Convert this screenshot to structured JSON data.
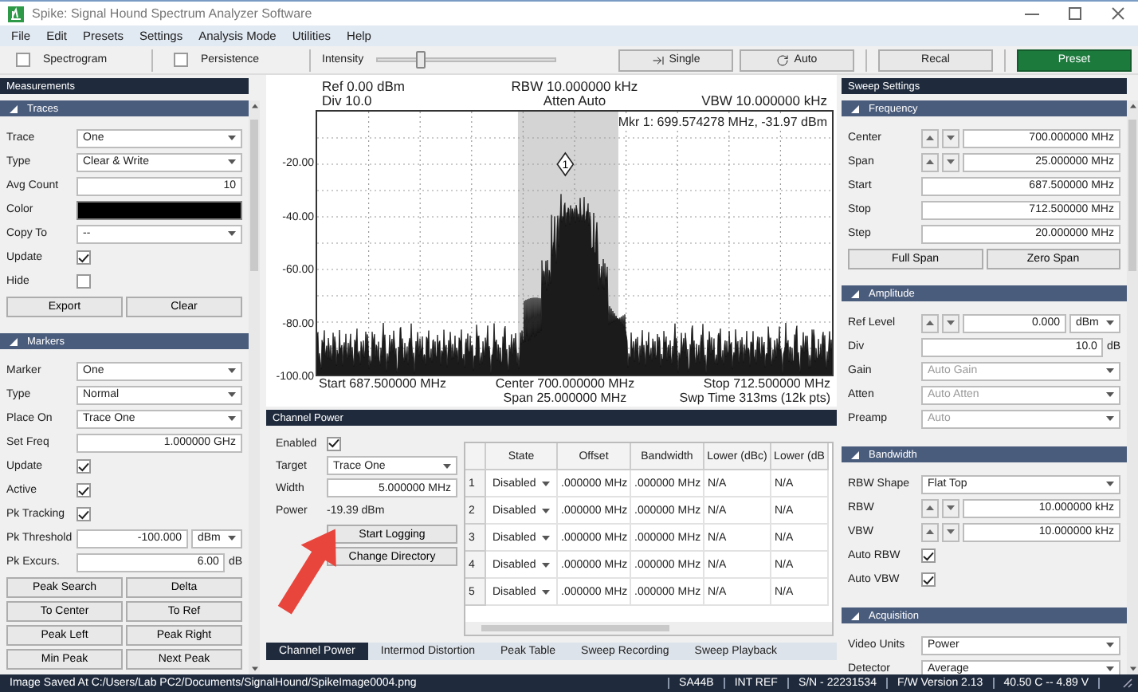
{
  "window": {
    "title": "Spike: Signal Hound Spectrum Analyzer Software"
  },
  "menu": [
    "File",
    "Edit",
    "Presets",
    "Settings",
    "Analysis Mode",
    "Utilities",
    "Help"
  ],
  "toolbar": {
    "checks": [
      {
        "label": "Spectrogram",
        "checked": false
      },
      {
        "label": "Persistence",
        "checked": false
      }
    ],
    "intensity": {
      "label": "Intensity",
      "level": 0.24
    },
    "buttons": [
      {
        "label": "Single",
        "kind": "single"
      },
      {
        "label": "Auto",
        "kind": "auto"
      },
      {
        "label": "Recal",
        "kind": "plain"
      },
      {
        "label": "Preset",
        "kind": "primary"
      }
    ]
  },
  "left_panel": {
    "title": "Measurements",
    "sections": [
      {
        "title": "Traces",
        "rows": [
          {
            "kind": "select",
            "label": "Trace",
            "value": "One",
            "disabled": false
          },
          {
            "kind": "select",
            "label": "Type",
            "value": "Clear & Write",
            "disabled": false
          },
          {
            "kind": "input",
            "label": "Avg Count",
            "value": "10"
          },
          {
            "kind": "color",
            "label": "Color",
            "color": "#000000"
          },
          {
            "kind": "select",
            "label": "Copy To",
            "value": "--",
            "disabled": false
          },
          {
            "kind": "check",
            "label": "Update",
            "checked": true
          },
          {
            "kind": "check",
            "label": "Hide",
            "checked": false
          }
        ],
        "buttons": [
          "Export",
          "Clear"
        ]
      },
      {
        "title": "Markers",
        "rows": [
          {
            "kind": "select",
            "label": "Marker",
            "value": "One",
            "disabled": false
          },
          {
            "kind": "select",
            "label": "Type",
            "value": "Normal",
            "disabled": false
          },
          {
            "kind": "select",
            "label": "Place On",
            "value": "Trace One",
            "disabled": false
          },
          {
            "kind": "input",
            "label": "Set Freq",
            "value": "1.000000 GHz"
          },
          {
            "kind": "check",
            "label": "Update",
            "checked": true
          },
          {
            "kind": "check",
            "label": "Active",
            "checked": true
          },
          {
            "kind": "check",
            "label": "Pk Tracking",
            "checked": true
          },
          {
            "kind": "input_select",
            "label": "Pk Threshold",
            "value": "-100.000",
            "unit_select": "dBm"
          },
          {
            "kind": "input",
            "label": "Pk Excurs.",
            "value": "6.00",
            "unit": "dB"
          }
        ],
        "buttons": [
          "Peak Search",
          "Delta",
          "To Center",
          "To Ref",
          "Peak Left",
          "Peak Right",
          "Min Peak",
          "Next Peak"
        ]
      }
    ]
  },
  "spectrum": {
    "ref": "Ref 0.00 dBm",
    "div": "Div 10.0",
    "rbw": "RBW 10.000000 kHz",
    "atten": "Atten Auto",
    "vbw": "VBW 10.000000 kHz",
    "marker_readout": "Mkr 1: 699.574278 MHz, -31.97 dBm",
    "marker_number": "1",
    "y_labels": [
      "-20.00",
      "-40.00",
      "-60.00",
      "-80.00",
      "-100.00"
    ],
    "start": "Start 687.500000 MHz",
    "center": "Center 700.000000 MHz",
    "span": "Span 25.000000 MHz",
    "stop": "Stop 712.500000 MHz",
    "sweep_time": "Swp Time 313ms (12k pts)"
  },
  "channel_power": {
    "title": "Channel Power",
    "enabled": {
      "label": "Enabled",
      "checked": true
    },
    "target": {
      "label": "Target",
      "value": "Trace One"
    },
    "width": {
      "label": "Width",
      "value": "5.000000 MHz"
    },
    "power": {
      "label": "Power",
      "value": "-19.39 dBm"
    },
    "buttons": [
      "Start Logging",
      "Change Directory"
    ],
    "table": {
      "columns": [
        "State",
        "Offset",
        "Bandwidth",
        "Lower (dBc)",
        "Lower (dB"
      ],
      "rows": [
        {
          "index": "1",
          "state": "Disabled",
          "offset": ".000000 MHz",
          "bandwidth": ".000000 MHz",
          "lower_dbc": "N/A",
          "lower_db": "N/A"
        },
        {
          "index": "2",
          "state": "Disabled",
          "offset": ".000000 MHz",
          "bandwidth": ".000000 MHz",
          "lower_dbc": "N/A",
          "lower_db": "N/A"
        },
        {
          "index": "3",
          "state": "Disabled",
          "offset": ".000000 MHz",
          "bandwidth": ".000000 MHz",
          "lower_dbc": "N/A",
          "lower_db": "N/A"
        },
        {
          "index": "4",
          "state": "Disabled",
          "offset": ".000000 MHz",
          "bandwidth": ".000000 MHz",
          "lower_dbc": "N/A",
          "lower_db": "N/A"
        },
        {
          "index": "5",
          "state": "Disabled",
          "offset": ".000000 MHz",
          "bandwidth": ".000000 MHz",
          "lower_dbc": "N/A",
          "lower_db": "N/A"
        }
      ]
    }
  },
  "bottom_tabs": [
    {
      "label": "Channel Power",
      "selected": true
    },
    {
      "label": "Intermod Distortion",
      "selected": false
    },
    {
      "label": "Peak Table",
      "selected": false
    },
    {
      "label": "Sweep Recording",
      "selected": false
    },
    {
      "label": "Sweep Playback",
      "selected": false
    }
  ],
  "right_panel": {
    "title": "Sweep Settings",
    "sections": [
      {
        "title": "Frequency",
        "rows": [
          {
            "kind": "spin",
            "label": "Center",
            "value": "700.000000 MHz"
          },
          {
            "kind": "spin",
            "label": "Span",
            "value": "25.000000 MHz"
          },
          {
            "kind": "input",
            "label": "Start",
            "value": "687.500000 MHz"
          },
          {
            "kind": "input",
            "label": "Stop",
            "value": "712.500000 MHz"
          },
          {
            "kind": "input",
            "label": "Step",
            "value": "20.000000 MHz"
          }
        ],
        "buttons": [
          "Full Span",
          "Zero Span"
        ]
      },
      {
        "title": "Amplitude",
        "rows": [
          {
            "kind": "spin",
            "label": "Ref Level",
            "value": "0.000",
            "unit_select": "dBm"
          },
          {
            "kind": "input",
            "label": "Div",
            "value": "10.0",
            "unit": "dB"
          },
          {
            "kind": "select",
            "label": "Gain",
            "value": "Auto Gain",
            "disabled": true
          },
          {
            "kind": "select",
            "label": "Atten",
            "value": "Auto Atten",
            "disabled": true
          },
          {
            "kind": "select",
            "label": "Preamp",
            "value": "Auto",
            "disabled": true
          }
        ]
      },
      {
        "title": "Bandwidth",
        "rows": [
          {
            "kind": "select",
            "label": "RBW Shape",
            "value": "Flat Top",
            "disabled": false
          },
          {
            "kind": "spin",
            "label": "RBW",
            "value": "10.000000 kHz"
          },
          {
            "kind": "spin",
            "label": "VBW",
            "value": "10.000000 kHz"
          },
          {
            "kind": "check",
            "label": "Auto RBW",
            "checked": true
          },
          {
            "kind": "check",
            "label": "Auto VBW",
            "checked": true
          }
        ]
      },
      {
        "title": "Acquisition",
        "rows": [
          {
            "kind": "select",
            "label": "Video Units",
            "value": "Power",
            "disabled": false
          },
          {
            "kind": "select",
            "label": "Detector",
            "value": "Average",
            "disabled": false
          }
        ]
      }
    ]
  },
  "status_bar": [
    "Image Saved At C:/Users/Lab PC2/Documents/SignalHound/SpikeImage0004.png",
    "SA44B",
    "INT REF",
    "S/N - 22231534",
    "F/W Version 2.13",
    "40.50 C -- 4.89 V"
  ]
}
